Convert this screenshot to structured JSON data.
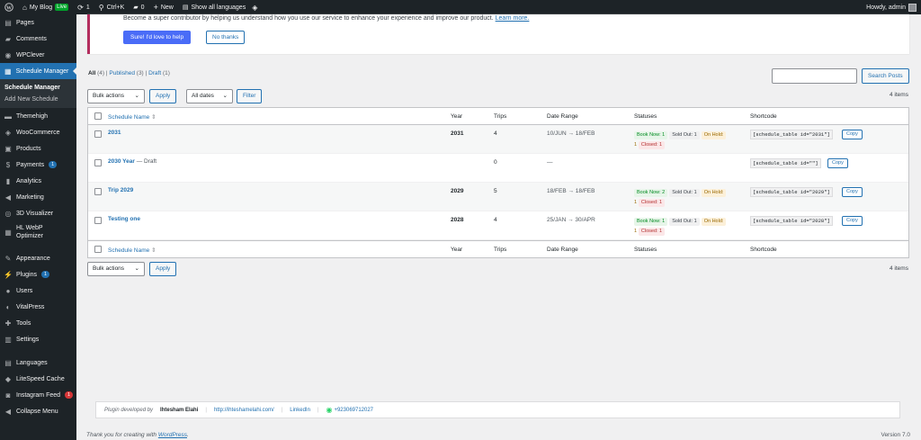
{
  "adminbar": {
    "site_name": "My Blog",
    "live": "Live",
    "updates": "1",
    "search_shortcut": "Ctrl+K",
    "comments": "0",
    "new": "New",
    "languages": "Show all languages",
    "howdy": "Howdy, admin"
  },
  "sidebar": {
    "items": [
      {
        "label": "Pages",
        "icon": "pages-icon",
        "glyph": "▤"
      },
      {
        "label": "Comments",
        "icon": "comments-icon",
        "glyph": "▰"
      },
      {
        "label": "WPClever",
        "icon": "wpclever-icon",
        "glyph": "◉"
      },
      {
        "label": "Schedule Manager",
        "icon": "calendar-icon",
        "glyph": "▦"
      }
    ],
    "submenu": [
      "Schedule Manager",
      "Add New Schedule"
    ],
    "items2": [
      {
        "label": "Themehigh",
        "icon": "themehigh-icon",
        "glyph": "▬"
      },
      {
        "label": "WooCommerce",
        "icon": "woocommerce-icon",
        "glyph": "◈"
      },
      {
        "label": "Products",
        "icon": "products-icon",
        "glyph": "▣"
      },
      {
        "label": "Payments",
        "icon": "payments-icon",
        "glyph": "$",
        "badge": "1"
      },
      {
        "label": "Analytics",
        "icon": "analytics-icon",
        "glyph": "▮"
      },
      {
        "label": "Marketing",
        "icon": "marketing-icon",
        "glyph": "◀"
      },
      {
        "label": "3D Visualizer",
        "icon": "visualizer-icon",
        "glyph": "◎"
      },
      {
        "label": "HL WebP",
        "label2": "Optimizer",
        "icon": "webp-icon",
        "glyph": "▦"
      }
    ],
    "items3": [
      {
        "label": "Appearance",
        "icon": "appearance-icon",
        "glyph": "✎"
      },
      {
        "label": "Plugins",
        "icon": "plugins-icon",
        "glyph": "⚡",
        "badge": "1"
      },
      {
        "label": "Users",
        "icon": "users-icon",
        "glyph": "●"
      },
      {
        "label": "VitalPress",
        "icon": "vitalpress-icon",
        "glyph": "◐"
      },
      {
        "label": "Tools",
        "icon": "tools-icon",
        "glyph": "✚"
      },
      {
        "label": "Settings",
        "icon": "settings-icon",
        "glyph": "▥"
      }
    ],
    "items4": [
      {
        "label": "Languages",
        "icon": "languages-icon",
        "glyph": "▤"
      },
      {
        "label": "LiteSpeed Cache",
        "icon": "litespeed-icon",
        "glyph": "◆"
      },
      {
        "label": "Instagram Feed",
        "icon": "instagram-icon",
        "glyph": "◙",
        "badge": "1"
      },
      {
        "label": "Collapse Menu",
        "icon": "collapse-icon",
        "glyph": "◀"
      }
    ]
  },
  "notice": {
    "text": "Become a super contributor by helping us understand how you use our service to enhance your experience and improve our product.",
    "link": "Learn more.",
    "primary": "Sure! I'd love to help",
    "secondary": "No thanks"
  },
  "filters": {
    "all": "All",
    "all_count": "(4)",
    "published": "Published",
    "published_count": "(3)",
    "draft": "Draft",
    "draft_count": "(1)",
    "sep": "|"
  },
  "search": {
    "button": "Search Posts",
    "value": ""
  },
  "tablenav": {
    "bulk_actions": "Bulk actions",
    "apply": "Apply",
    "all_dates": "All dates",
    "filter": "Filter",
    "items": "4 items"
  },
  "table": {
    "headers": {
      "name": "Schedule Name",
      "year": "Year",
      "trips": "Trips",
      "date_range": "Date Range",
      "statuses": "Statuses",
      "shortcode": "Shortcode"
    },
    "rows": [
      {
        "name": "2031",
        "state": "",
        "year": "2031",
        "trips": "4",
        "range": "10/JUN → 18/FEB",
        "book": "Book Now: 1",
        "sold": "Sold Out: 1",
        "hold": "On Hold:",
        "hold_n": "1",
        "closed": "Closed: 1",
        "shortcode": "[schedule_table id=\"2031\"]",
        "copy": "Copy"
      },
      {
        "name": "2030 Year",
        "state": " — Draft",
        "year": "",
        "trips": "0",
        "range": "—",
        "book": "",
        "sold": "",
        "hold": "",
        "hold_n": "",
        "closed": "",
        "shortcode": "[schedule_table id=\"\"]",
        "copy": "Copy"
      },
      {
        "name": "Trip 2029",
        "state": "",
        "year": "2029",
        "trips": "5",
        "range": "18/FEB → 18/FEB",
        "book": "Book Now: 2",
        "sold": "Sold Out: 1",
        "hold": "On Hold:",
        "hold_n": "1",
        "closed": "Closed: 1",
        "shortcode": "[schedule_table id=\"2029\"]",
        "copy": "Copy"
      },
      {
        "name": "Testing one",
        "state": "",
        "year": "2028",
        "trips": "4",
        "range": "25/JAN → 30/APR",
        "book": "Book Now: 1",
        "sold": "Sold Out: 1",
        "hold": "On Hold:",
        "hold_n": "1",
        "closed": "Closed: 1",
        "shortcode": "[schedule_table id=\"2028\"]",
        "copy": "Copy"
      }
    ]
  },
  "dev_footer": {
    "developed_by": "Plugin developed by",
    "author": "Ihtesham Elahi",
    "site": "http://ihteshamelahi.com/",
    "linkedin": "LinkedIn",
    "phone": "+923069712027",
    "pipe": "|"
  },
  "wp_footer": {
    "thanks": "Thank you for creating with",
    "wordpress": "WordPress",
    "dot": ".",
    "version": "Version 7.0"
  },
  "colors": {
    "accent": "#2271b1",
    "sidebar": "#1d2327",
    "primary_button": "#4a6cf7",
    "notice_border": "#b32d5e"
  }
}
